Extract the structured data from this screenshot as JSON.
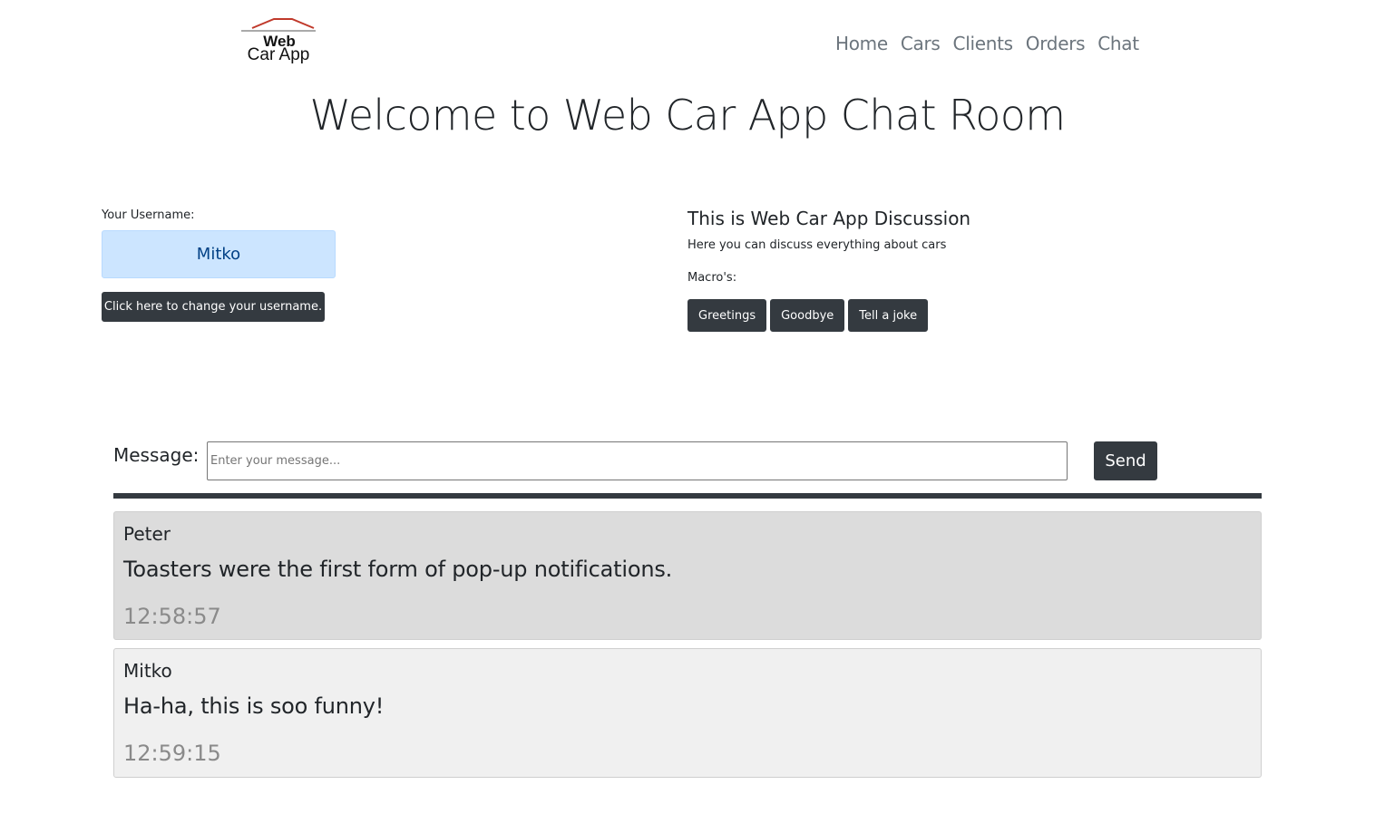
{
  "logo": {
    "line1": "Web",
    "line2": "Car App",
    "accent_color": "#c0392b"
  },
  "nav": {
    "items": [
      {
        "label": "Home"
      },
      {
        "label": "Cars"
      },
      {
        "label": "Clients"
      },
      {
        "label": "Orders"
      },
      {
        "label": "Chat"
      }
    ]
  },
  "page_title": "Welcome to Web Car App Chat Room",
  "user": {
    "label": "Your Username:",
    "name": "Mitko",
    "change_button": "Click here to change your username."
  },
  "discussion": {
    "title": "This is Web Car App Discussion",
    "subtitle": "Here you can discuss everything about cars",
    "macros_label": "Macro's:",
    "macros": [
      "Greetings",
      "Goodbye",
      "Tell a joke"
    ]
  },
  "composer": {
    "label": "Message:",
    "placeholder": "Enter your message...",
    "value": "",
    "send_label": "Send"
  },
  "messages": [
    {
      "author": "Peter",
      "text": "Toasters were the first form of pop-up notifications.",
      "time": "12:58:57",
      "bg": "#dcdcdc"
    },
    {
      "author": "Mitko",
      "text": "Ha-ha, this is soo funny!",
      "time": "12:59:15",
      "bg": "#f0f0f0"
    }
  ],
  "colors": {
    "dark_button": "#343a40",
    "username_box": "#cce5ff",
    "username_text": "#004085",
    "nav_text": "#6c757d"
  }
}
